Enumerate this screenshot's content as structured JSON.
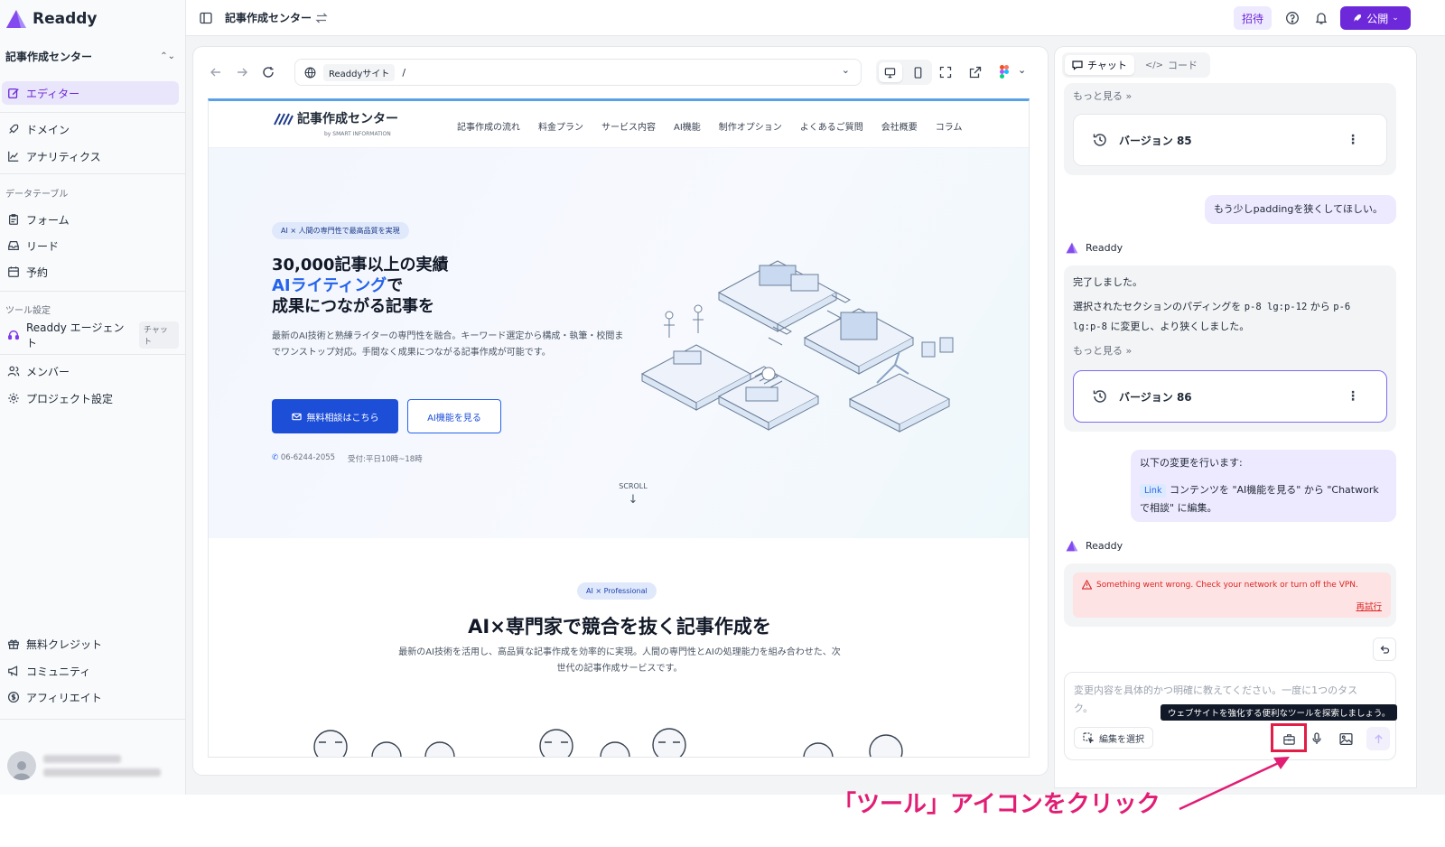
{
  "brand": {
    "name": "Readdy"
  },
  "sidebar": {
    "project": "記事作成センター",
    "editor": "エディター",
    "domain": "ドメイン",
    "analytics": "アナリティクス",
    "section_data": "データテーブル",
    "forms": "フォーム",
    "leads": "リード",
    "booking": "予約",
    "section_tools": "ツール設定",
    "agent": "Readdy エージェント",
    "agent_tag": "チャット",
    "members": "メンバー",
    "project_settings": "プロジェクト設定",
    "free_credit": "無料クレジット",
    "community": "コミュニティ",
    "affiliate": "アフィリエイト"
  },
  "topbar": {
    "title": "記事作成センター",
    "invite": "招待",
    "publish": "公開"
  },
  "address": {
    "site": "Readdyサイト",
    "path": "/"
  },
  "preview": {
    "logo": "記事作成センター",
    "logo_sub": "by SMART INFORMATION",
    "nav": [
      "記事作成の流れ",
      "料金プラン",
      "サービス内容",
      "AI機能",
      "制作オプション",
      "よくあるご質問",
      "会社概要",
      "コラム"
    ],
    "hero_badge": "AI × 人間の専門性で最高品質を実現",
    "hero_line1": "30,000記事以上の実績",
    "hero_line2_blue": "AIライティング",
    "hero_line2_rest": "で",
    "hero_line3": "成果につながる記事を",
    "hero_desc": "最新のAI技術と熟練ライターの専門性を融合。キーワード選定から構成・執筆・校閲までワンストップ対応。手間なく成果につながる記事作成が可能です。",
    "btn_primary": "無料相談はこちら",
    "btn_secondary": "AI機能を見る",
    "phone": "06-6244-2055",
    "hours": "受付:平日10時~18時",
    "scroll": "SCROLL",
    "s2_badge": "AI × Professional",
    "s2_title": "AI×専門家で競合を抜く記事作成を",
    "s2_desc": "最新のAI技術を活用し、高品質な記事作成を効率的に実現。人間の専門性とAIの処理能力を組み合わせた、次世代の記事作成サービスです。"
  },
  "chat": {
    "tab_chat": "チャット",
    "tab_code": "コード",
    "more": "もっと見る",
    "version85": "バージョン 85",
    "user_msg1": "もう少しpaddingを狭くしてほしい。",
    "bot_name": "Readdy",
    "done": "完了しました。",
    "bot_detail_a": "選択されたセクションのパディングを",
    "code_from": "p-8 lg:p-12",
    "bot_detail_b": "から",
    "code_to_1": "p-6",
    "code_to_2": "lg:p-8",
    "bot_detail_c": "に変更し、より狭くしました。",
    "version86": "バージョン 86",
    "user_msg2_title": "以下の変更を行います:",
    "link_tag": "Link",
    "user_msg2_a": "コンテンツを \"AI機能を見る\" から \"Chatwork",
    "user_msg2_b": "で相談\" に編集。",
    "error": "Something went wrong. Check your network or turn off the VPN.",
    "retry": "再試行",
    "placeholder": "変更内容を具体的かつ明確に教えてください。一度に1つのタスク。",
    "select_edit": "編集を選択",
    "tooltip": "ウェブサイトを強化する便利なツールを探索しましょう。"
  },
  "annotation": "「ツール」アイコンをクリック",
  "colors": {
    "accent": "#6d28d9",
    "highlight": "#e11d48",
    "annotation": "#e11d74",
    "preview_blue": "#1d4ed8"
  }
}
